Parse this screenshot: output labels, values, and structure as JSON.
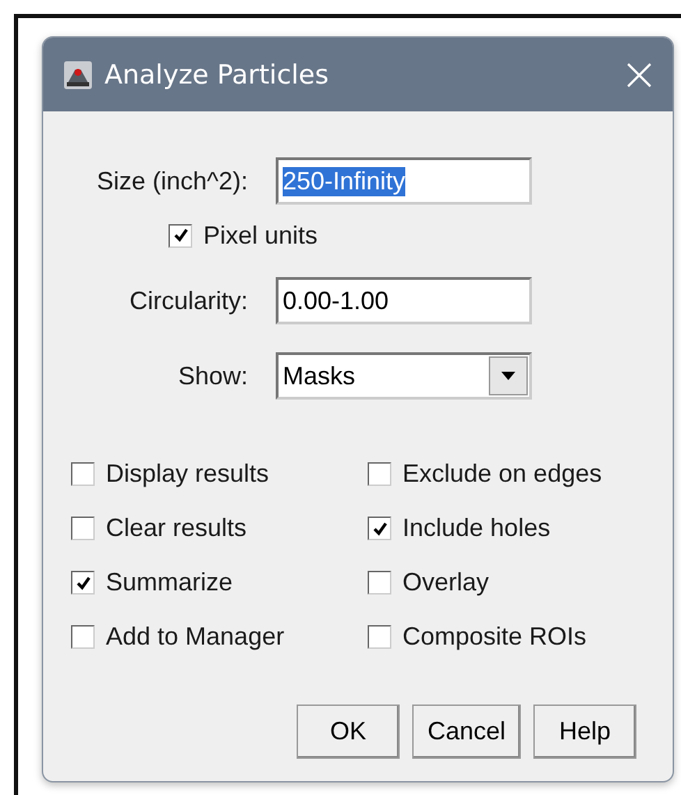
{
  "window": {
    "title": "Analyze Particles"
  },
  "fields": [
    {
      "kind": "text",
      "label": "Size (inch^2):",
      "value": "250-Infinity",
      "text_selected": true
    },
    {
      "kind": "checkbox",
      "label": "Pixel units",
      "checked": true
    },
    {
      "kind": "text",
      "label": "Circularity:",
      "value": "0.00-1.00",
      "text_selected": false
    },
    {
      "kind": "dropdown",
      "label": "Show:",
      "value": "Masks"
    }
  ],
  "options": [
    {
      "label": "Display results",
      "checked": false
    },
    {
      "label": "Exclude on edges",
      "checked": false
    },
    {
      "label": "Clear results",
      "checked": false
    },
    {
      "label": "Include holes",
      "checked": true
    },
    {
      "label": "Summarize",
      "checked": true
    },
    {
      "label": "Overlay",
      "checked": false
    },
    {
      "label": "Add to Manager",
      "checked": false
    },
    {
      "label": "Composite ROIs",
      "checked": false
    }
  ],
  "buttons": [
    "OK",
    "Cancel",
    "Help"
  ]
}
